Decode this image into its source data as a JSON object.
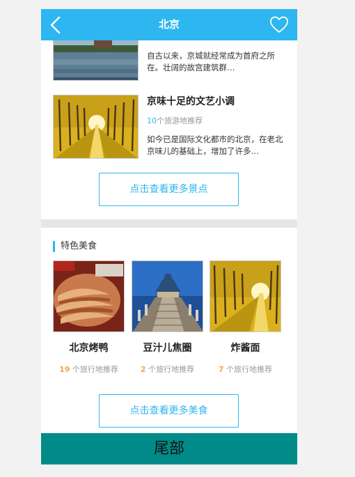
{
  "header": {
    "title": "北京",
    "back_icon": "chevron-left-icon",
    "favorite_icon": "heart-outline-icon",
    "bg_color": "#2db6ef"
  },
  "spots": [
    {
      "desc": "自古以来，京城就经常成为首府之所在。壮阔的故宫建筑群…"
    },
    {
      "name": "京味十足的文艺小调",
      "rec_num": "10",
      "rec_text": "个旅游地推荐",
      "desc": "如今已是国际文化都市的北京，在老北京味儿的基础上，增加了许多…"
    }
  ],
  "more_spots_label": "点击查看更多景点",
  "food_section": {
    "title": "特色美食",
    "items": [
      {
        "name": "北京烤鸭",
        "rec_num": "19",
        "rec_text": " 个旅行地推荐"
      },
      {
        "name": "豆汁儿焦圈",
        "rec_num": "2",
        "rec_text": " 个旅行地推荐"
      },
      {
        "name": "炸酱面",
        "rec_num": "7",
        "rec_text": " 个旅行地推荐"
      }
    ],
    "more_label": "点击查看更多美食"
  },
  "footer": {
    "label": "尾部",
    "bg_color": "#008b88"
  }
}
